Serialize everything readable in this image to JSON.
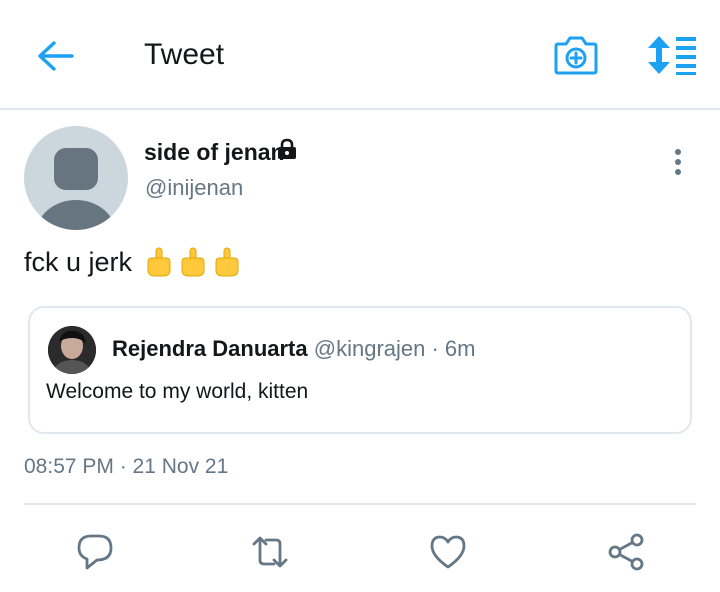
{
  "colors": {
    "accent": "#1da1f2",
    "text": "#14171a",
    "secondary": "#657786",
    "divider": "#e1e8ed",
    "action_icon": "#657786",
    "emoji": "#ffc83d"
  },
  "header": {
    "title": "Tweet",
    "icons": [
      "back-arrow-icon",
      "camera-icon",
      "timeline-sort-icon"
    ]
  },
  "tweet": {
    "display_name": "side of jenan",
    "handle": "@inijenan",
    "protected": true,
    "text": "fck u jerk",
    "emoji": [
      "middle-finger-emoji",
      "middle-finger-emoji",
      "middle-finger-emoji"
    ],
    "timestamp": "08:57 PM · 21 Nov 21"
  },
  "quoted_tweet": {
    "display_name": "Rejendra Danuarta",
    "meta": "@kingrajen · 6m",
    "text": "Welcome to my world, kitten"
  },
  "actions": [
    {
      "name": "reply",
      "icon": "reply-icon"
    },
    {
      "name": "retweet",
      "icon": "retweet-icon"
    },
    {
      "name": "like",
      "icon": "heart-icon"
    },
    {
      "name": "share",
      "icon": "share-icon"
    }
  ]
}
